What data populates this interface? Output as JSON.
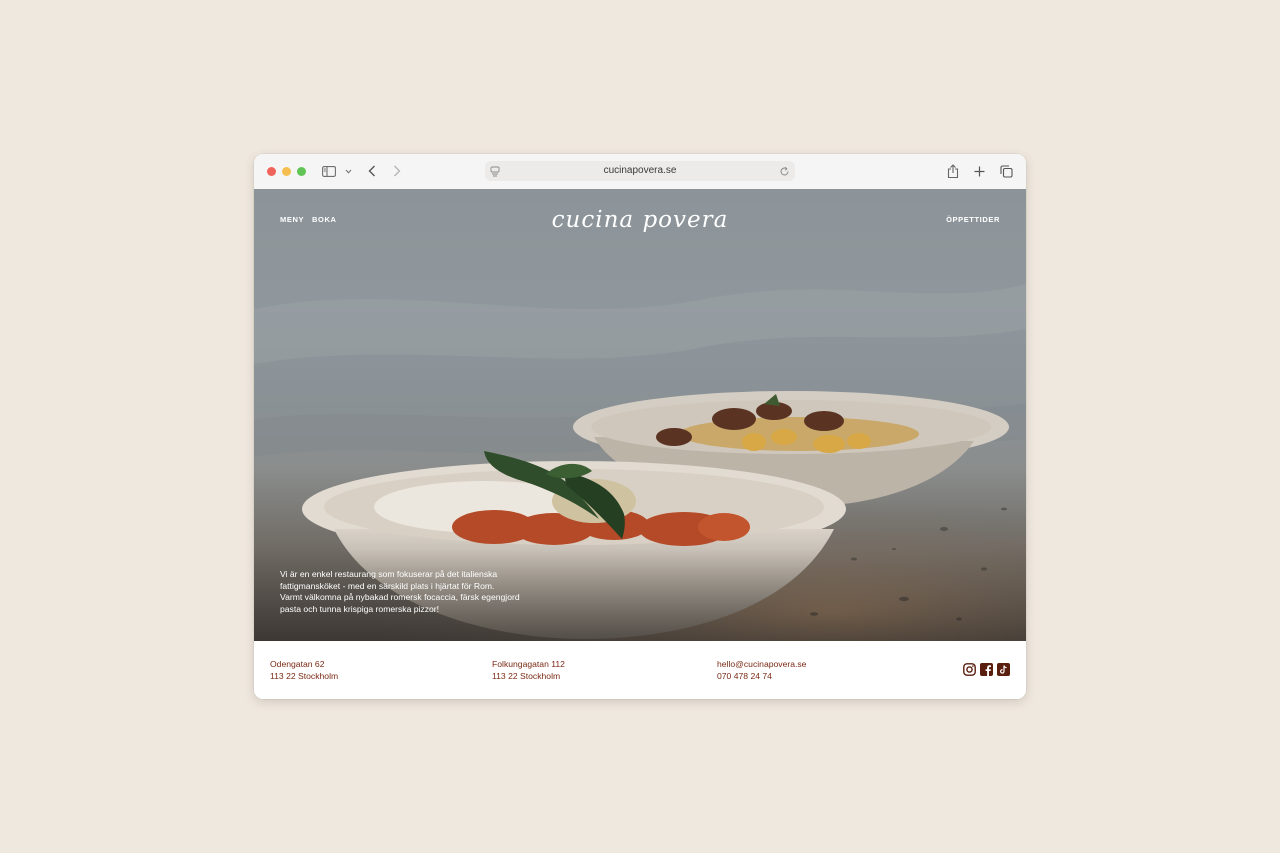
{
  "browser": {
    "url": "cucinapovera.se"
  },
  "site": {
    "nav_left": [
      "MENY",
      "BOKA"
    ],
    "nav_right": "ÖPPETTIDER",
    "logo_text": "cucina povera",
    "intro_lines": [
      "Vi är en enkel restaurang som fokuserar på det italienska",
      "fattigmansköket - med en särskild plats i hjärtat för Rom.",
      "Varmt välkomna på nybakad romersk focaccia, färsk egengjord",
      "pasta och tunna krispiga romerska pizzor!"
    ]
  },
  "footer": {
    "location1": {
      "street": "Odengatan 62",
      "city": "113 22 Stockholm"
    },
    "location2": {
      "street": "Folkungagatan 112",
      "city": "113 22 Stockholm"
    },
    "contact": {
      "email": "hello@cucinapovera.se",
      "phone": "070 478 24 74"
    },
    "social_icons": [
      "instagram-icon",
      "facebook-icon",
      "tiktok-icon"
    ]
  },
  "colors": {
    "page_background": "#efe8df",
    "footer_text": "#7a2a14",
    "hero_text": "#ffffff"
  }
}
